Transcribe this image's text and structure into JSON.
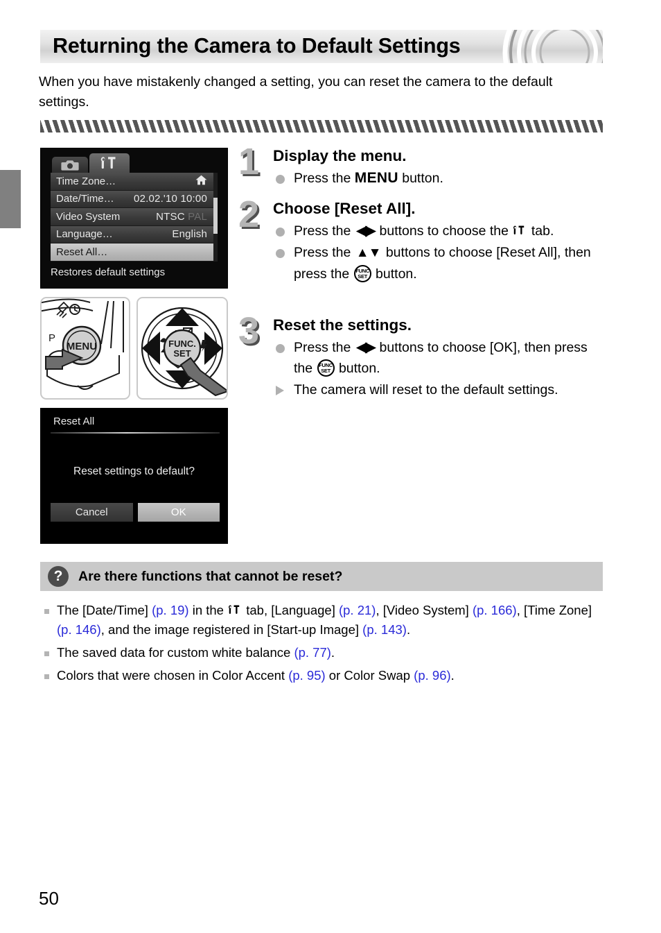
{
  "header": {
    "title": "Returning the Camera to Default Settings"
  },
  "intro": "When you have mistakenly changed a setting, you can reset the camera to the default settings.",
  "lcd_menu": {
    "tabs": [
      {
        "icon": "camera-icon",
        "state": "inactive"
      },
      {
        "icon": "wrench-hammer-icon",
        "state": "active"
      }
    ],
    "rows": [
      {
        "label": "Time Zone…",
        "value": "",
        "value_icon": "home-icon",
        "selected": false
      },
      {
        "label": "Date/Time…",
        "value": "02.02.'10 10:00",
        "selected": false
      },
      {
        "label": "Video System",
        "value": "NTSC",
        "value_dim": "PAL",
        "selected": false
      },
      {
        "label": "Language…",
        "value": "English",
        "selected": false
      },
      {
        "label": "Reset All…",
        "value": "",
        "selected": true
      }
    ],
    "hint": "Restores default settings"
  },
  "illustrations": {
    "menu_button": {
      "name": "menu-button-illustration",
      "label": "MENU",
      "mode_label": "P"
    },
    "nav_pad": {
      "name": "navigation-pad-illustration",
      "center_top": "FUNC.",
      "center_bottom": "SET"
    }
  },
  "lcd_dialog": {
    "title": "Reset All",
    "message": "Reset settings to default?",
    "buttons": [
      {
        "label": "Cancel",
        "selected": false
      },
      {
        "label": "OK",
        "selected": true
      }
    ]
  },
  "steps": [
    {
      "number": "1",
      "title": "Display the menu.",
      "lines": [
        {
          "marker": "dot",
          "parts": [
            {
              "t": "text",
              "v": "Press the "
            },
            {
              "t": "menu",
              "v": "MENU"
            },
            {
              "t": "text",
              "v": " button."
            }
          ]
        }
      ]
    },
    {
      "number": "2",
      "title": "Choose [Reset All].",
      "lines": [
        {
          "marker": "dot",
          "parts": [
            {
              "t": "text",
              "v": "Press the "
            },
            {
              "t": "lr",
              "v": "◀▶"
            },
            {
              "t": "text",
              "v": " buttons to choose the "
            },
            {
              "t": "tool",
              "v": "wrench-hammer-icon"
            },
            {
              "t": "text",
              "v": " tab."
            }
          ]
        },
        {
          "marker": "dot",
          "parts": [
            {
              "t": "text",
              "v": "Press the "
            },
            {
              "t": "ud",
              "v": "▲▼"
            },
            {
              "t": "text",
              "v": " buttons to choose [Reset All], then press the "
            },
            {
              "t": "func",
              "v": "FUNC/SET"
            },
            {
              "t": "text",
              "v": " button."
            }
          ]
        }
      ]
    },
    {
      "number": "3",
      "title": "Reset the settings.",
      "lines": [
        {
          "marker": "dot",
          "parts": [
            {
              "t": "text",
              "v": "Press the "
            },
            {
              "t": "lr",
              "v": "◀▶"
            },
            {
              "t": "text",
              "v": " buttons to choose [OK], then press the "
            },
            {
              "t": "func",
              "v": "FUNC/SET"
            },
            {
              "t": "text",
              "v": " button."
            }
          ]
        },
        {
          "marker": "triangle",
          "parts": [
            {
              "t": "text",
              "v": "The camera will reset to the default settings."
            }
          ]
        }
      ]
    }
  ],
  "faq": {
    "icon": "question-mark-icon",
    "title": "Are there functions that cannot be reset?",
    "items": [
      {
        "parts": [
          {
            "t": "text",
            "v": "The [Date/Time] "
          },
          {
            "t": "ref",
            "v": "(p. 19)"
          },
          {
            "t": "text",
            "v": " in the "
          },
          {
            "t": "tool",
            "v": "wrench-hammer-icon"
          },
          {
            "t": "text",
            "v": " tab, [Language] "
          },
          {
            "t": "ref",
            "v": "(p. 21)"
          },
          {
            "t": "text",
            "v": ", [Video System] "
          },
          {
            "t": "ref",
            "v": "(p. 166)"
          },
          {
            "t": "text",
            "v": ", [Time Zone] "
          },
          {
            "t": "ref",
            "v": "(p. 146)"
          },
          {
            "t": "text",
            "v": ", and the image registered in [Start-up Image] "
          },
          {
            "t": "ref",
            "v": "(p. 143)"
          },
          {
            "t": "text",
            "v": "."
          }
        ]
      },
      {
        "parts": [
          {
            "t": "text",
            "v": "The saved data for custom white balance "
          },
          {
            "t": "ref",
            "v": "(p. 77)"
          },
          {
            "t": "text",
            "v": "."
          }
        ]
      },
      {
        "parts": [
          {
            "t": "text",
            "v": "Colors that were chosen in Color Accent "
          },
          {
            "t": "ref",
            "v": "(p. 95)"
          },
          {
            "t": "text",
            "v": " or Color Swap "
          },
          {
            "t": "ref",
            "v": "(p. 96)"
          },
          {
            "t": "text",
            "v": "."
          }
        ]
      }
    ]
  },
  "page_number": "50",
  "colors": {
    "reference_link": "#2a2ad8",
    "faq_bar": "#c9c9c9",
    "hatch": "#555555",
    "edge_tab": "#808080",
    "step_number": "#b5b5b5"
  }
}
